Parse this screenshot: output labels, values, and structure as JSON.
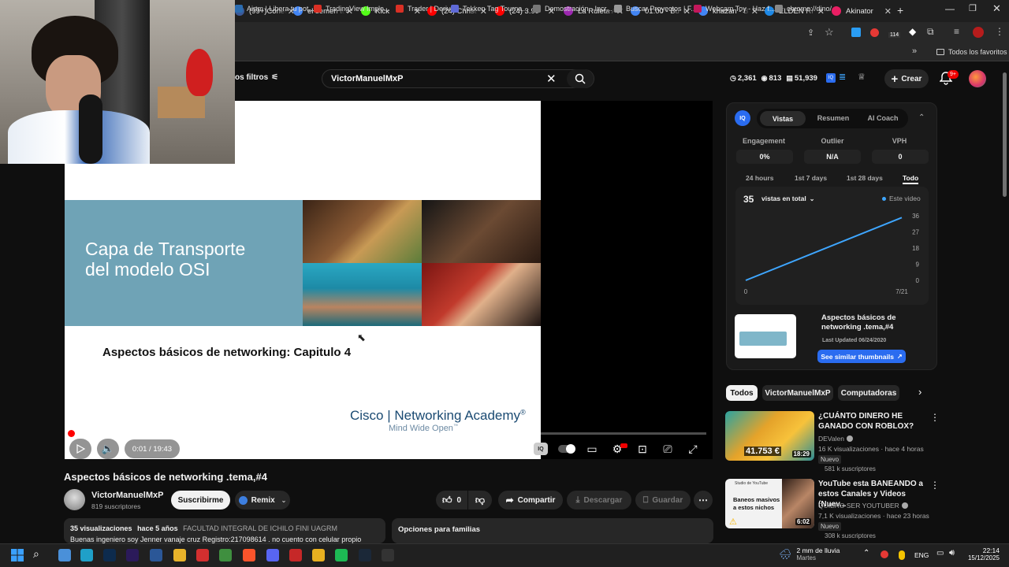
{
  "browser": {
    "tabs": [
      {
        "label": "(99+)Conec",
        "color": "#3b5998"
      },
      {
        "label": "el semen tu",
        "color": "#4285f4"
      },
      {
        "label": "Kick",
        "color": "#53fc18"
      },
      {
        "label": "(24) Christ",
        "color": "#ff0000"
      },
      {
        "label": "(24) 3.99",
        "color": "#ff0000"
      },
      {
        "label": "La Ruleta A",
        "color": "#9c27b0"
      },
      {
        "label": "01:00 - Bú",
        "color": "#4285f4"
      },
      {
        "label": "khazan - B",
        "color": "#4285f4"
      },
      {
        "label": "ELDEN RI",
        "color": "#1e88e5"
      },
      {
        "label": "Akinator",
        "color": "#e91e63"
      }
    ],
    "new_tab": "+",
    "bookmarks": [
      {
        "label": "Airtm | Libera tu pot...",
        "color": "#2b6cb0"
      },
      {
        "label": "TradingView Imple...",
        "color": "#d93025"
      },
      {
        "label": "Trader | Deriv",
        "color": "#d93025"
      },
      {
        "label": "Tekken Tag Tourna...",
        "color": "#5f6ad7"
      },
      {
        "label": "Demostración - Incr...",
        "color": "#777777"
      },
      {
        "label": "Buscar Proyectos | F...",
        "color": "#999999"
      },
      {
        "label": "Webcam Toy - Haz f...",
        "color": "#c2185b"
      },
      {
        "label": "chrome://dino/",
        "color": "#888888"
      }
    ],
    "all_bookmarks": "Todos los favoritos",
    "ext_badge": "114"
  },
  "yt_header": {
    "filters_label": "os filtros",
    "search_value": "VictorManuelMxP",
    "stats": [
      "2,361",
      "813",
      "51,939"
    ],
    "create_label": "Crear",
    "notif_badge": "9+"
  },
  "player": {
    "slide_title": "Capa de Transporte\ndel modelo OSI",
    "slide_subtitle": "Aspectos básicos de networking: Capitulo 4",
    "slide_brand": "Cisco | Networking Academy",
    "slide_brand_mark": "®",
    "slide_tagline": "Mind Wide Open",
    "slide_tagline_mark": "™",
    "time": "0:01 / 19:43",
    "progress": 0.001
  },
  "video": {
    "title": "Aspectos básicos de networking .tema,#4",
    "channel": "VictorManuelMxP",
    "subscribers": "819 suscriptores",
    "subscribe": "Suscribirme",
    "remix": "Remix",
    "likes": "0",
    "share": "Compartir",
    "download": "Descargar",
    "save": "Guardar",
    "views": "35 visualizaciones",
    "age": "hace 5 años",
    "tag": "FACULTAD INTEGRAL DE ICHILO FINI UAGRM",
    "desc": "Buenas ingeniero soy Jenner vanaje cruz  Registro:217098614 . no cuento con celular propio",
    "family": "Opciones para familias"
  },
  "iq": {
    "tabs": [
      "Vistas",
      "Resumen",
      "AI Coach"
    ],
    "metrics": [
      {
        "label": "Engagement",
        "value": "0%"
      },
      {
        "label": "Outlier",
        "value": "N/A"
      },
      {
        "label": "VPH",
        "value": "0"
      }
    ],
    "ranges": [
      "24 hours",
      "1st 7 days",
      "1st 28 days",
      "Todo"
    ],
    "total": "35",
    "total_label": "vistas en total",
    "legend": "Este video",
    "chart_data": {
      "type": "line",
      "x": [
        "0",
        "7/21"
      ],
      "y_ticks": [
        0,
        9,
        18,
        27,
        36
      ],
      "series": [
        {
          "name": "Este video",
          "x": [
            "0",
            "7/21"
          ],
          "values": [
            0,
            35
          ]
        }
      ],
      "ylim": [
        0,
        36
      ],
      "color": "#3ea6ff"
    },
    "thumb_title": "Aspectos básicos de networking .tema,#4",
    "last_updated": "Last Updated 06/24/2020",
    "similar_btn": "See similar thumbnails"
  },
  "chips": [
    "Todos",
    "VictorManuelMxP",
    "Computadoras"
  ],
  "recs": [
    {
      "title": "¿CUÁNTO DINERO HE GANADO CON ROBLOX?",
      "channel": "DEValen",
      "meta": "16 K visualizaciones · hace 4 horas",
      "badge": "Nuevo",
      "subs": "581 k suscriptores",
      "duration": "18:29",
      "thumb_text": "41.753 €"
    },
    {
      "title": "YouTube esta BANEANDO a estos Canales y Videos (Nuev...",
      "channel": "QUIERO SER YOUTUBER",
      "meta": "7,1 K visualizaciones · hace 23 horas",
      "badge": "Nuevo",
      "subs": "308 k suscriptores",
      "duration": "6:02",
      "thumb_text": "Baneos masivos a estos nichos",
      "thumb_header": "Studio de YouTube"
    }
  ],
  "taskbar": {
    "weather": "2 mm de lluvia",
    "weather_sub": "Martes",
    "lang": "ENG",
    "time": "22:14",
    "date": "15/12/2025"
  }
}
